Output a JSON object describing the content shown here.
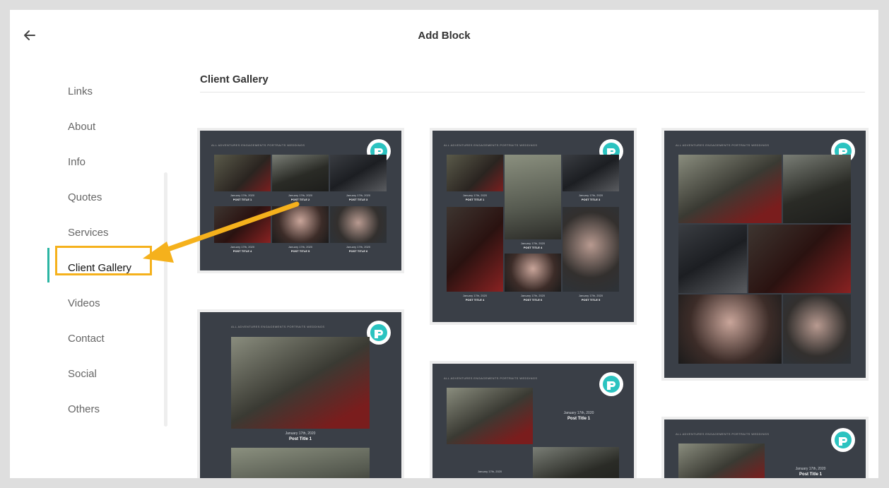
{
  "header": {
    "title": "Add Block",
    "back_icon": "arrow-left-icon"
  },
  "sidebar": {
    "items": [
      {
        "label": "Links"
      },
      {
        "label": "About"
      },
      {
        "label": "Info"
      },
      {
        "label": "Quotes"
      },
      {
        "label": "Services"
      },
      {
        "label": "Client Gallery",
        "active": true
      },
      {
        "label": "Videos"
      },
      {
        "label": "Contact"
      },
      {
        "label": "Social"
      },
      {
        "label": "Others"
      }
    ]
  },
  "main": {
    "section_title": "Client Gallery",
    "template_nav": "ALL   ADVENTURES   ENGAGEMENTS   PORTRAITS   WEDDINGS",
    "captions": {
      "date1": "January 17th, 2020",
      "date2": "January 18th, 2020",
      "date3": "January 19th, 2020",
      "title1": "POST TITLE 1",
      "title2": "POST TITLE 2",
      "title3": "POST TITLE 3",
      "title4": "POST TITLE 4",
      "title5": "POST TITLE 5",
      "title6": "POST TITLE 6",
      "post_title_1": "Post Title 1"
    }
  },
  "colors": {
    "accent": "#2bb5a3",
    "highlight": "#f5b11c",
    "card_bg": "#3a3f47",
    "logo": "#2bc3c0"
  }
}
